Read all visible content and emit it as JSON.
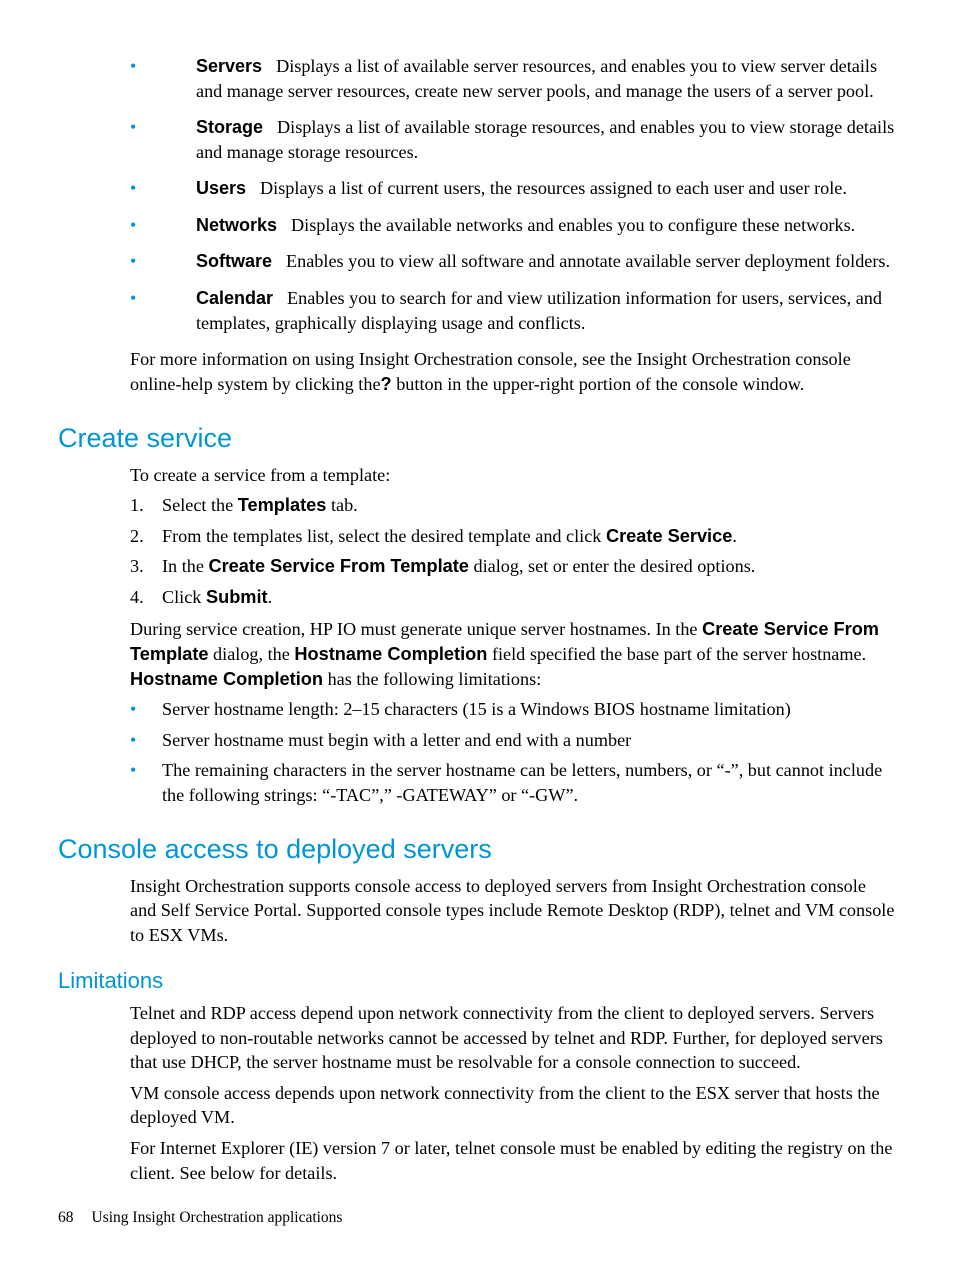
{
  "topBullets": [
    {
      "label": "Servers",
      "desc": "Displays a list of available server resources, and enables you to view server details and manage server resources, create new server pools, and manage the users of a server pool."
    },
    {
      "label": "Storage",
      "desc": "Displays a list of available storage resources, and enables you to view storage details and manage storage resources."
    },
    {
      "label": "Users",
      "desc": "Displays a list of current users, the resources assigned to each user and user role."
    },
    {
      "label": "Networks",
      "desc": "Displays the available networks and enables you to configure these networks."
    },
    {
      "label": "Software",
      "desc": "Enables you to view all software and annotate available server deployment folders."
    },
    {
      "label": "Calendar",
      "desc": "Enables you to search for and view utilization information for users, services, and templates, graphically displaying usage and conflicts."
    }
  ],
  "moreInfo": {
    "pre": "For more information on using Insight Orchestration console, see the Insight Orchestration console online-help system by clicking the",
    "qmark": "?",
    "post": " button in the upper-right portion of the console window."
  },
  "createService": {
    "heading": "Create service",
    "intro": "To create a service from a template:",
    "step1": {
      "a": "Select the ",
      "b": "Templates",
      "c": " tab."
    },
    "step2": {
      "a": "From the templates list, select the desired template and click ",
      "b": "Create Service",
      "c": "."
    },
    "step3": {
      "a": "In the ",
      "b": "Create Service From Template",
      "c": " dialog, set or enter the desired options."
    },
    "step4": {
      "a": "Click ",
      "b": "Submit",
      "c": "."
    },
    "p2": {
      "a": "During service creation, HP IO must generate unique server hostnames. In the ",
      "b": "Create Service From Template",
      "c": " dialog, the ",
      "d": "Hostname Completion",
      "e": " field specified the base part of the server hostname. ",
      "f": "Hostname Completion",
      "g": " has the following limitations:"
    },
    "limits": [
      "Server hostname length: 2–15 characters (15 is a Windows BIOS hostname limitation)",
      "Server hostname must begin with a letter and end with a number",
      "The remaining characters in the server hostname can be letters, numbers, or “-”, but cannot include the following strings: “-TAC”,” -GATEWAY” or “-GW”."
    ]
  },
  "consoleAccess": {
    "heading": "Console access to deployed servers",
    "p1": "Insight Orchestration supports console access to deployed servers from Insight Orchestration console and Self Service Portal. Supported console types include Remote Desktop (RDP), telnet and VM console to ESX VMs.",
    "limitationsHeading": "Limitations",
    "l1": "Telnet and RDP access depend upon network connectivity from the client to deployed servers. Servers deployed to non-routable networks cannot be accessed by telnet and RDP. Further, for deployed servers that use DHCP, the server hostname must be resolvable for a console connection to succeed.",
    "l2": "VM console access depends upon network connectivity from the client to the ESX server that hosts the deployed VM.",
    "l3": "For Internet Explorer (IE) version 7 or later, telnet console must be enabled by editing the registry on the client. See below for details."
  },
  "footer": {
    "pageNumber": "68",
    "chapter": "Using Insight Orchestration applications"
  }
}
